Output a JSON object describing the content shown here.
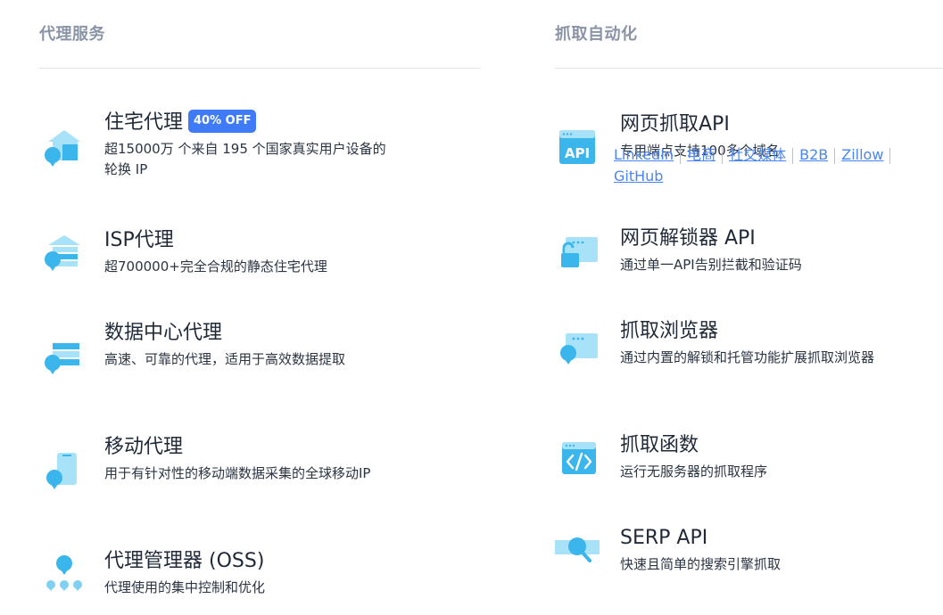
{
  "left_section": {
    "header": "代理服务",
    "items": [
      {
        "icon": "residential-proxy-icon",
        "title": "住宅代理",
        "badge": "40% OFF",
        "desc": "超15000万 个来自 195 个国家真实用户设备的轮换 IP"
      },
      {
        "icon": "isp-proxy-icon",
        "title": "ISP代理",
        "desc": "超700000+完全合规的静态住宅代理"
      },
      {
        "icon": "datacenter-proxy-icon",
        "title": "数据中心代理",
        "desc": "高速、可靠的代理，适用于高效数据提取"
      },
      {
        "icon": "mobile-proxy-icon",
        "title": "移动代理",
        "desc": "用于有针对性的移动端数据采集的全球移动IP"
      },
      {
        "icon": "proxy-manager-icon",
        "title": "代理管理器 (OSS)",
        "desc": "代理使用的集中控制和优化"
      }
    ]
  },
  "right_section": {
    "header": "抓取自动化",
    "items": [
      {
        "icon": "web-scraper-api-icon",
        "icon_label": "API",
        "title": "网页抓取API",
        "desc": "专用端点支持100多个域名"
      },
      {
        "icon": "web-unlocker-icon",
        "title": "网页解锁器 API",
        "desc": "通过单一API告别拦截和验证码"
      },
      {
        "icon": "scraping-browser-icon",
        "title": "抓取浏览器",
        "desc": "通过内置的解锁和托管功能扩展抓取浏览器"
      },
      {
        "icon": "scraper-functions-icon",
        "title": "抓取函数",
        "desc": "运行无服务器的抓取程序"
      },
      {
        "icon": "serp-api-icon",
        "title": "SERP API",
        "desc": "快速且简单的搜索引擎抓取"
      }
    ]
  },
  "overlay_links": [
    "LinkedIn",
    "电商",
    "社交媒体",
    "B2B",
    "Zillow",
    "GitHub"
  ],
  "colors": {
    "icon_primary": "#3bb6ec",
    "icon_light": "#a8e2f8",
    "badge": "#3f7bf7",
    "link": "#4a86f2",
    "header": "#8a94a6"
  }
}
